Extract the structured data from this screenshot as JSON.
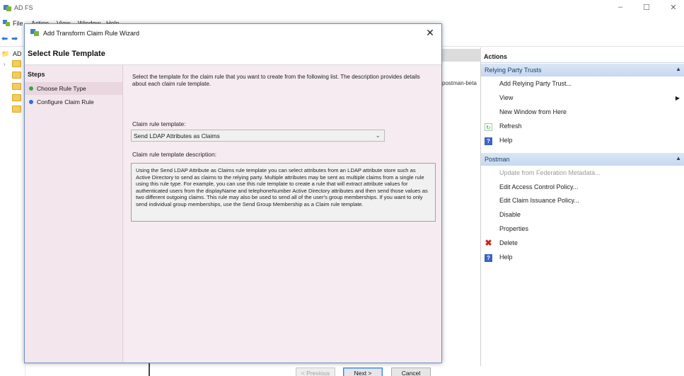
{
  "app": {
    "title": "AD FS",
    "menu": [
      "File",
      "Action",
      "View",
      "Window",
      "Help"
    ],
    "window_controls": {
      "minimize": "–",
      "maximize": "☐",
      "close": "✕"
    },
    "inner_controls": "- ♂ ×"
  },
  "tree": {
    "root_label": "AD"
  },
  "center": {
    "cell_text": "postman-beta"
  },
  "actions": {
    "header": "Actions",
    "sections": [
      {
        "title": "Relying Party Trusts",
        "items": [
          {
            "label": "Add Relying Party Trust...",
            "icon": "",
            "enabled": true,
            "submenu": false
          },
          {
            "label": "View",
            "icon": "",
            "enabled": true,
            "submenu": true
          },
          {
            "label": "New Window from Here",
            "icon": "",
            "enabled": true,
            "submenu": false
          },
          {
            "label": "Refresh",
            "icon": "refresh-icon",
            "enabled": true,
            "submenu": false
          },
          {
            "label": "Help",
            "icon": "help-icon",
            "enabled": true,
            "submenu": false
          }
        ]
      },
      {
        "title": "Postman",
        "items": [
          {
            "label": "Update from Federation Metadata...",
            "icon": "",
            "enabled": false,
            "submenu": false
          },
          {
            "label": "Edit Access Control Policy...",
            "icon": "",
            "enabled": true,
            "submenu": false
          },
          {
            "label": "Edit Claim Issuance Policy...",
            "icon": "",
            "enabled": true,
            "submenu": false
          },
          {
            "label": "Disable",
            "icon": "",
            "enabled": true,
            "submenu": false
          },
          {
            "label": "Properties",
            "icon": "",
            "enabled": true,
            "submenu": false
          },
          {
            "label": "Delete",
            "icon": "delete-icon",
            "enabled": true,
            "submenu": false
          },
          {
            "label": "Help",
            "icon": "help-icon",
            "enabled": true,
            "submenu": false
          }
        ]
      }
    ]
  },
  "wizard": {
    "title": "Add Transform Claim Rule Wizard",
    "heading": "Select Rule Template",
    "steps_label": "Steps",
    "steps": [
      {
        "label": "Choose Rule Type",
        "current": true,
        "dot_color": "#2fa84f"
      },
      {
        "label": "Configure Claim Rule",
        "current": false,
        "dot_color": "#2b6fd6"
      }
    ],
    "intro": "Select the template for the claim rule that you want to create from the following list. The description provides details about each claim rule template.",
    "template_label": "Claim rule template:",
    "template_value": "Send LDAP Attributes as Claims",
    "description_label": "Claim rule template description:",
    "description": "Using the Send LDAP Attribute as Claims rule template you can select attributes from an LDAP attribute store such as Active Directory to send as claims to the relying party. Multiple attributes may be sent as multiple claims from a single rule using this rule type. For example, you can use this rule template to create a rule that will extract attribute values for authenticated users from the displayName and telephoneNumber Active Directory attributes and then send those values as two different outgoing claims. This rule may also be used to send all of the user's group memberships. If you want to only send individual group memberships, use the Send Group Membership as a Claim rule template.",
    "buttons": {
      "previous": "< Previous",
      "next": "Next >",
      "cancel": "Cancel"
    }
  }
}
